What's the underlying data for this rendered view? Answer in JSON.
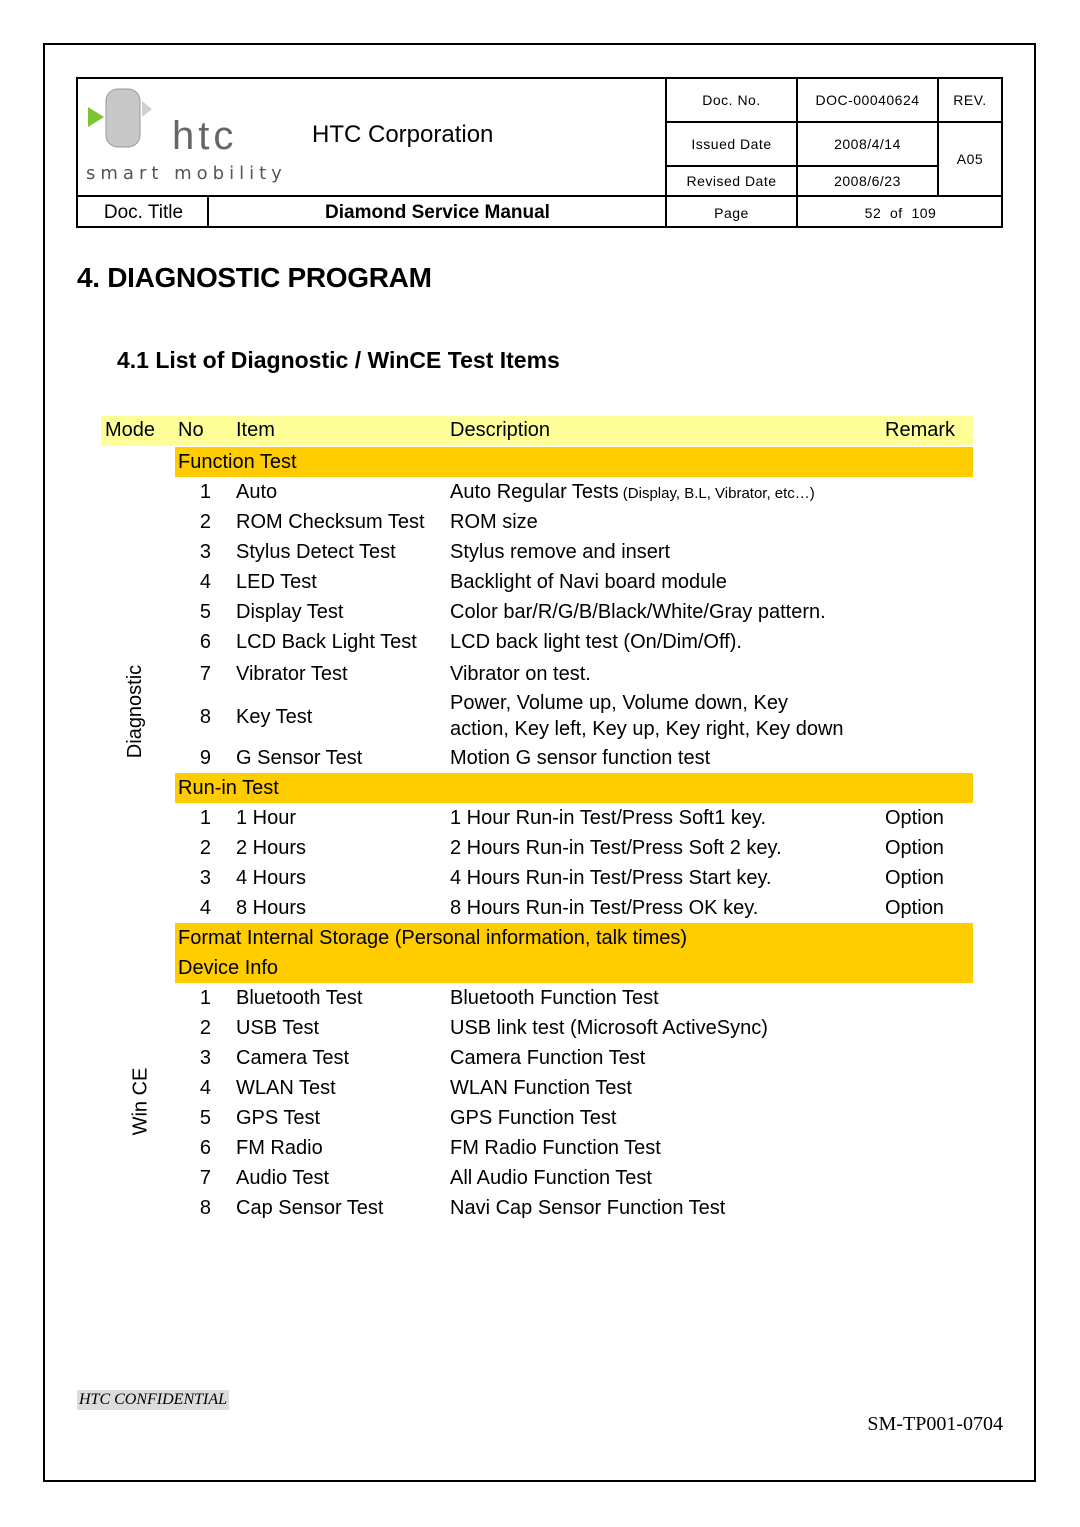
{
  "header": {
    "logo_text": "htc",
    "logo_tagline": "smart mobility",
    "company": "HTC Corporation",
    "doc_title_label": "Doc. Title",
    "doc_title": "Diamond Service Manual",
    "doc_no_label": "Doc. No.",
    "doc_no": "DOC-00040624",
    "rev_label": "REV.",
    "rev": "A05",
    "issued_label": "Issued Date",
    "issued": "2008/4/14",
    "revised_label": "Revised Date",
    "revised": "2008/6/23",
    "page_label": "Page",
    "page": "52  of  109"
  },
  "heading": "4.  DIAGNOSTIC PROGRAM",
  "subheading": "4.1  List of Diagnostic / WinCE Test Items",
  "table": {
    "columns": {
      "mode": "Mode",
      "no": "No",
      "item": "Item",
      "description": "Description",
      "remark": "Remark"
    },
    "modes": [
      "Diagnostic",
      "Win CE"
    ],
    "function_test": {
      "title": "Function Test",
      "rows": [
        {
          "no": "1",
          "item": "Auto",
          "desc": "Auto Regular Tests",
          "desc_small": " (Display, B.L, Vibrator, etc…)"
        },
        {
          "no": "2",
          "item": "ROM Checksum Test",
          "desc": "ROM size"
        },
        {
          "no": "3",
          "item": "Stylus Detect Test",
          "desc": "Stylus remove and insert"
        },
        {
          "no": "4",
          "item": "LED Test",
          "desc": "Backlight of Navi board module"
        },
        {
          "no": "5",
          "item": "Display Test",
          "desc": "Color bar/R/G/B/Black/White/Gray pattern."
        },
        {
          "no": "6",
          "item": "LCD Back Light Test",
          "desc": "LCD back light test (On/Dim/Off)."
        },
        {
          "no": "7",
          "item": "Vibrator Test",
          "desc": "Vibrator on test."
        },
        {
          "no": "8",
          "item": "Key Test",
          "desc": "Power, Volume up, Volume down, Key",
          "desc2": "action, Key left, Key up, Key right, Key down"
        },
        {
          "no": "9",
          "item": "G Sensor Test",
          "desc": "Motion G sensor function test"
        }
      ]
    },
    "runin_test": {
      "title": "Run-in Test",
      "rows": [
        {
          "no": "1",
          "item": "1 Hour",
          "desc": "1 Hour Run-in Test/Press Soft1 key.",
          "remark": "Option"
        },
        {
          "no": "2",
          "item": "2 Hours",
          "desc": "2 Hours Run-in Test/Press Soft 2 key.",
          "remark": "Option"
        },
        {
          "no": "3",
          "item": "4 Hours",
          "desc": "4 Hours Run-in Test/Press Start key.",
          "remark": "Option"
        },
        {
          "no": "4",
          "item": "8 Hours",
          "desc": "8 Hours Run-in Test/Press OK key.",
          "remark": "Option"
        }
      ]
    },
    "format_storage": "Format Internal Storage (Personal information, talk times)",
    "device_info": "Device Info",
    "wince": {
      "rows": [
        {
          "no": "1",
          "item": "Bluetooth Test",
          "desc": "Bluetooth Function Test"
        },
        {
          "no": "2",
          "item": "USB Test",
          "desc": "USB link test (Microsoft ActiveSync)"
        },
        {
          "no": "3",
          "item": "Camera Test",
          "desc": "Camera Function Test"
        },
        {
          "no": "4",
          "item": "WLAN Test",
          "desc": "WLAN Function Test"
        },
        {
          "no": "5",
          "item": "GPS Test",
          "desc": "GPS Function Test"
        },
        {
          "no": "6",
          "item": "FM Radio",
          "desc": "FM Radio Function Test"
        },
        {
          "no": "7",
          "item": "Audio Test",
          "desc": "All Audio Function Test"
        },
        {
          "no": "8",
          "item": "Cap Sensor Test",
          "desc": "Navi Cap Sensor Function Test"
        }
      ]
    }
  },
  "footer": {
    "confidential": "HTC CONFIDENTIAL",
    "doc_id": "SM-TP001-0704"
  },
  "colors": {
    "header_row": "#ffff99",
    "section_row": "#ffcc00"
  }
}
